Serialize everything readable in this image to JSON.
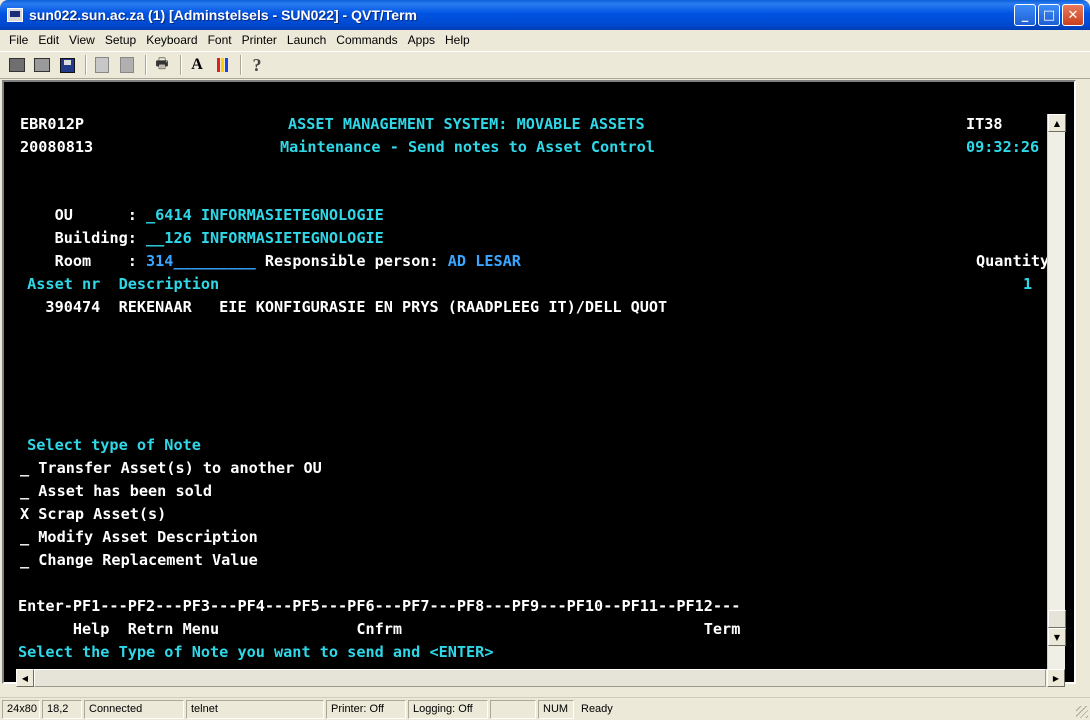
{
  "window": {
    "title": "sun022.sun.ac.za (1) [Adminstelsels - SUN022] - QVT/Term",
    "min_label": "_",
    "max_label": "□",
    "close_label": "✕"
  },
  "menu": [
    "File",
    "Edit",
    "View",
    "Setup",
    "Keyboard",
    "Font",
    "Printer",
    "Launch",
    "Commands",
    "Apps",
    "Help"
  ],
  "toolbar": {
    "icons": [
      "terminal-icon",
      "stacked-icon",
      "save-icon",
      "copy-icon",
      "paste-icon",
      "print-icon",
      "font-icon",
      "colors-icon",
      "help-icon"
    ],
    "font_glyph": "A",
    "help_glyph": "?",
    "print_glyph": "🖶",
    "colors": [
      "#e02020",
      "#ffd000",
      "#2040e0"
    ]
  },
  "terminal": {
    "program_id": "EBR012P",
    "system_title": "ASSET MANAGEMENT SYSTEM: MOVABLE ASSETS",
    "terminal_id": "IT38",
    "date": "20080813",
    "subtitle": "Maintenance - Send notes to Asset Control",
    "time": "09:32:26",
    "ou_label": "OU      : ",
    "ou_value": "_6414 INFORMASIETEGNOLOGIE",
    "building_label": "Building: ",
    "building_value": "__126 INFORMASIETEGNOLOGIE",
    "room_label": "Room    : ",
    "room_value": "314_________",
    "responsible_label": " Responsible person: ",
    "responsible_value": "AD LESAR",
    "quantity_header": "Quantity",
    "asset_header": " Asset nr  Description",
    "quantity_value": "1",
    "asset_row": "   390474  REKENAAR   EIE KONFIGURASIE EN PRYS (RAADPLEEG IT)/DELL QUOT",
    "note_heading": " Select type of Note",
    "note_options": [
      "_ Transfer Asset(s) to another OU",
      "_ Asset has been sold",
      "X Scrap Asset(s)",
      "_ Modify Asset Description",
      "_ Change Replacement Value"
    ],
    "pf_line": "Enter-PF1---PF2---PF3---PF4---PF5---PF6---PF7---PF8---PF9---PF10--PF11--PF12---",
    "pf_labels": "      Help  Retrn Menu               Cnfrm                                 Term",
    "message": "Select the Type of Note you want to send and <ENTER>"
  },
  "status": {
    "size": "24x80",
    "cursor": "18,2",
    "connection": "Connected",
    "protocol": "telnet",
    "printer": "Printer: Off",
    "logging": "Logging: Off",
    "blank": "",
    "num": "NUM",
    "ready": "Ready"
  }
}
